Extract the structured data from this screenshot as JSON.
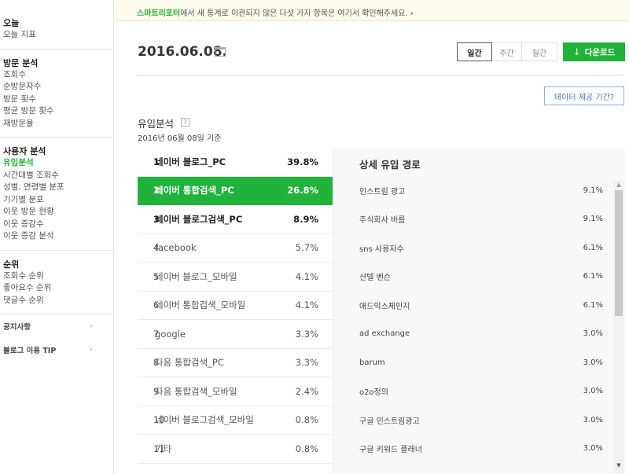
{
  "sidebar": {
    "groups": [
      {
        "title": "오늘",
        "items": [
          "오늘 지표"
        ]
      },
      {
        "title": "방문 분석",
        "items": [
          "조회수",
          "순방문자수",
          "방문 횟수",
          "평균 방문 횟수",
          "재방문율"
        ]
      },
      {
        "title": "사용자 분석",
        "items": [
          "유입분석",
          "시간대별 조회수",
          "성별, 연령별 분포",
          "기기별 분포",
          "이웃 방문 현황",
          "이웃 증감수",
          "이웃 증감 분석"
        ]
      },
      {
        "title": "순위",
        "items": [
          "조회수 순위",
          "좋아요수 순위",
          "댓글수 순위"
        ]
      }
    ],
    "links": [
      "공지사항",
      "블로그 이용 TIP"
    ],
    "link_arrow": "›"
  },
  "notice": {
    "highlight": "스마트리포터",
    "text": "에서 새 통계로 이관되지 않은 다섯 가지 항목은 여기서 확인해주세요. ›"
  },
  "header": {
    "date": "2016.06.08.",
    "period": {
      "day": "일간",
      "week": "주간",
      "month": "월간"
    },
    "download": "다운로드",
    "download_icon": "↓",
    "data_period": "데이터 제공 기간?"
  },
  "section": {
    "title": "유입분석",
    "help": "?",
    "subtitle": "2016년 06월 08일 기준"
  },
  "inflow": [
    {
      "rank": "1",
      "name": "네이버 블로그_PC",
      "pct": "39.8%"
    },
    {
      "rank": "2",
      "name": "네이버 통합검색_PC",
      "pct": "26.8%"
    },
    {
      "rank": "3",
      "name": "네이버 블로그검색_PC",
      "pct": "8.9%"
    },
    {
      "rank": "4",
      "name": "facebook",
      "pct": "5.7%"
    },
    {
      "rank": "5",
      "name": "네이버 블로그_모바일",
      "pct": "4.1%"
    },
    {
      "rank": "6",
      "name": "네이버 통합검색_모바일",
      "pct": "4.1%"
    },
    {
      "rank": "7",
      "name": "google",
      "pct": "3.3%"
    },
    {
      "rank": "8",
      "name": "다음 통합검색_PC",
      "pct": "3.3%"
    },
    {
      "rank": "9",
      "name": "다음 통합검색_모바일",
      "pct": "2.4%"
    },
    {
      "rank": "10",
      "name": "네이버 블로그검색_모바일",
      "pct": "0.8%"
    },
    {
      "rank": "11",
      "name": "기타",
      "pct": "0.8%"
    }
  ],
  "detail": {
    "title": "상세 유입 경로",
    "rows": [
      {
        "name": "인스트림 광고",
        "pct": "9.1%"
      },
      {
        "name": "주식회사 바름",
        "pct": "9.1%"
      },
      {
        "name": "sns 사용자수",
        "pct": "6.1%"
      },
      {
        "name": "샨텔 벤슨",
        "pct": "6.1%"
      },
      {
        "name": "애드익스체인지",
        "pct": "6.1%"
      },
      {
        "name": "ad exchange",
        "pct": "3.0%"
      },
      {
        "name": "barum",
        "pct": "3.0%"
      },
      {
        "name": "o2o정의",
        "pct": "3.0%"
      },
      {
        "name": "구글 인스트림광고",
        "pct": "3.0%"
      },
      {
        "name": "구글 키워드 플래너",
        "pct": "3.0%"
      }
    ]
  },
  "colors": {
    "accent": "#20b33a",
    "link": "#4a7ab8",
    "notice_bg": "#fdfbeb"
  }
}
